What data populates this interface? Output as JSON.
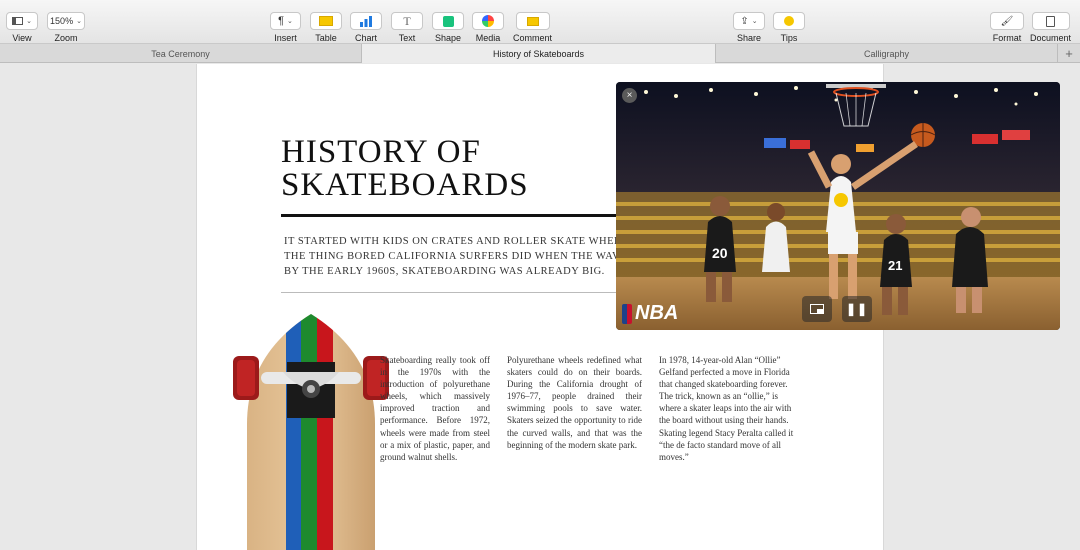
{
  "toolbar": {
    "view_label": "View",
    "zoom_value": "150%",
    "zoom_label": "Zoom",
    "insert_label": "Insert",
    "table_label": "Table",
    "chart_label": "Chart",
    "text_label": "Text",
    "shape_label": "Shape",
    "media_label": "Media",
    "comment_label": "Comment",
    "share_label": "Share",
    "tips_label": "Tips",
    "format_label": "Format",
    "document_label": "Document",
    "accent_color": "#f6c700"
  },
  "tabs": [
    {
      "label": "Tea Ceremony"
    },
    {
      "label": "History of Skateboards"
    },
    {
      "label": "Calligraphy"
    }
  ],
  "document": {
    "title_line1": "HISTORY OF",
    "title_line2": "SKATEBOARDS",
    "intro_line1": "IT STARTED WITH KIDS ON CRATES AND ROLLER SKATE WHEELS.",
    "intro_line2": "THE THING BORED CALIFORNIA SURFERS DID WHEN THE WAVES W",
    "intro_line3": "BY THE EARLY 1960S, SKATEBOARDING WAS ALREADY BIG.",
    "col1": "Skateboarding really took off in the 1970s with the introduction of polyurethane wheels, which massively improved traction and performance. Before 1972, wheels were made from steel or a mix of plastic, paper, and ground walnut shells.",
    "col2": "Polyurethane wheels redefined what skaters could do on their boards. During the California drought of 1976–77, people drained their swimming pools to save water. Skaters seized the opportunity to ride the curved walls, and that was the beginning of the modern skate park.",
    "col3": "In 1978, 14-year-old Alan “Ollie” Gelfand perfected a move in Florida that changed skateboarding forever. The trick, known as an “ollie,” is where a skater leaps into the air with the board without using their hands. Skating legend Stacy Peralta called it “the de facto standard move of all moves.”"
  },
  "video": {
    "logo_text": "NBA",
    "jersey_20": "20",
    "jersey_21": "21"
  }
}
